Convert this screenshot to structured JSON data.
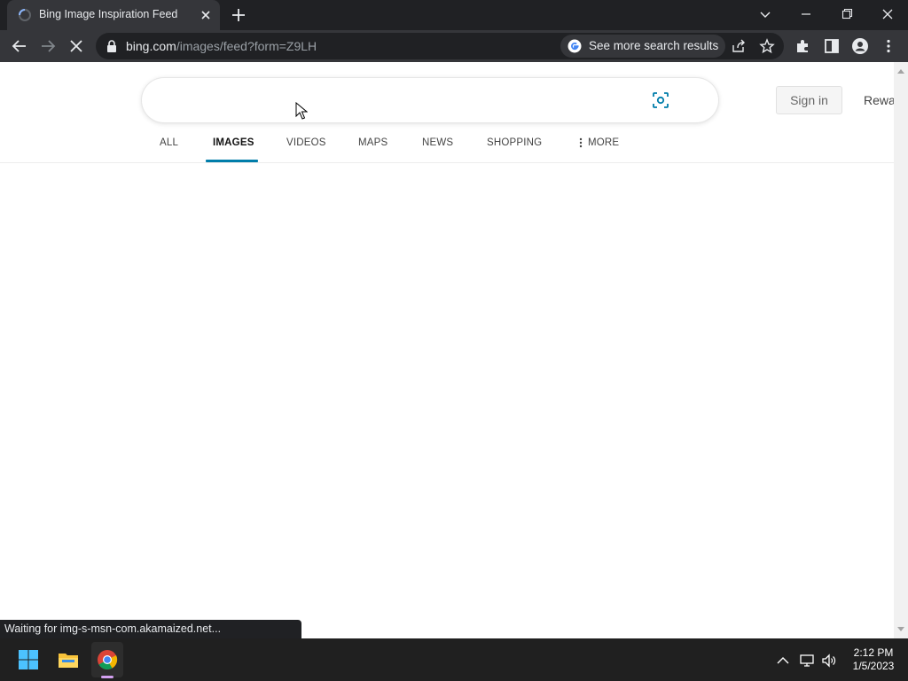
{
  "browser": {
    "tab_title": "Bing Image Inspiration Feed",
    "url_host": "bing.com",
    "url_path": "/images/feed?form=Z9LH",
    "search_chip_label": "See more search results",
    "status_text": "Waiting for img-s-msn-com.akamaized.net..."
  },
  "page": {
    "search_placeholder": "",
    "signin_label": "Sign in",
    "rewards_label": "Rewa",
    "nav": [
      {
        "label": "ALL"
      },
      {
        "label": "IMAGES",
        "active": true
      },
      {
        "label": "VIDEOS"
      },
      {
        "label": "MAPS"
      },
      {
        "label": "NEWS"
      },
      {
        "label": "SHOPPING"
      },
      {
        "label": "MORE"
      }
    ],
    "accent_color": "#007daa"
  },
  "taskbar": {
    "time": "2:12 PM",
    "date": "1/5/2023",
    "apps": [
      "windows-start-icon",
      "file-explorer-icon",
      "chrome-icon"
    ]
  }
}
